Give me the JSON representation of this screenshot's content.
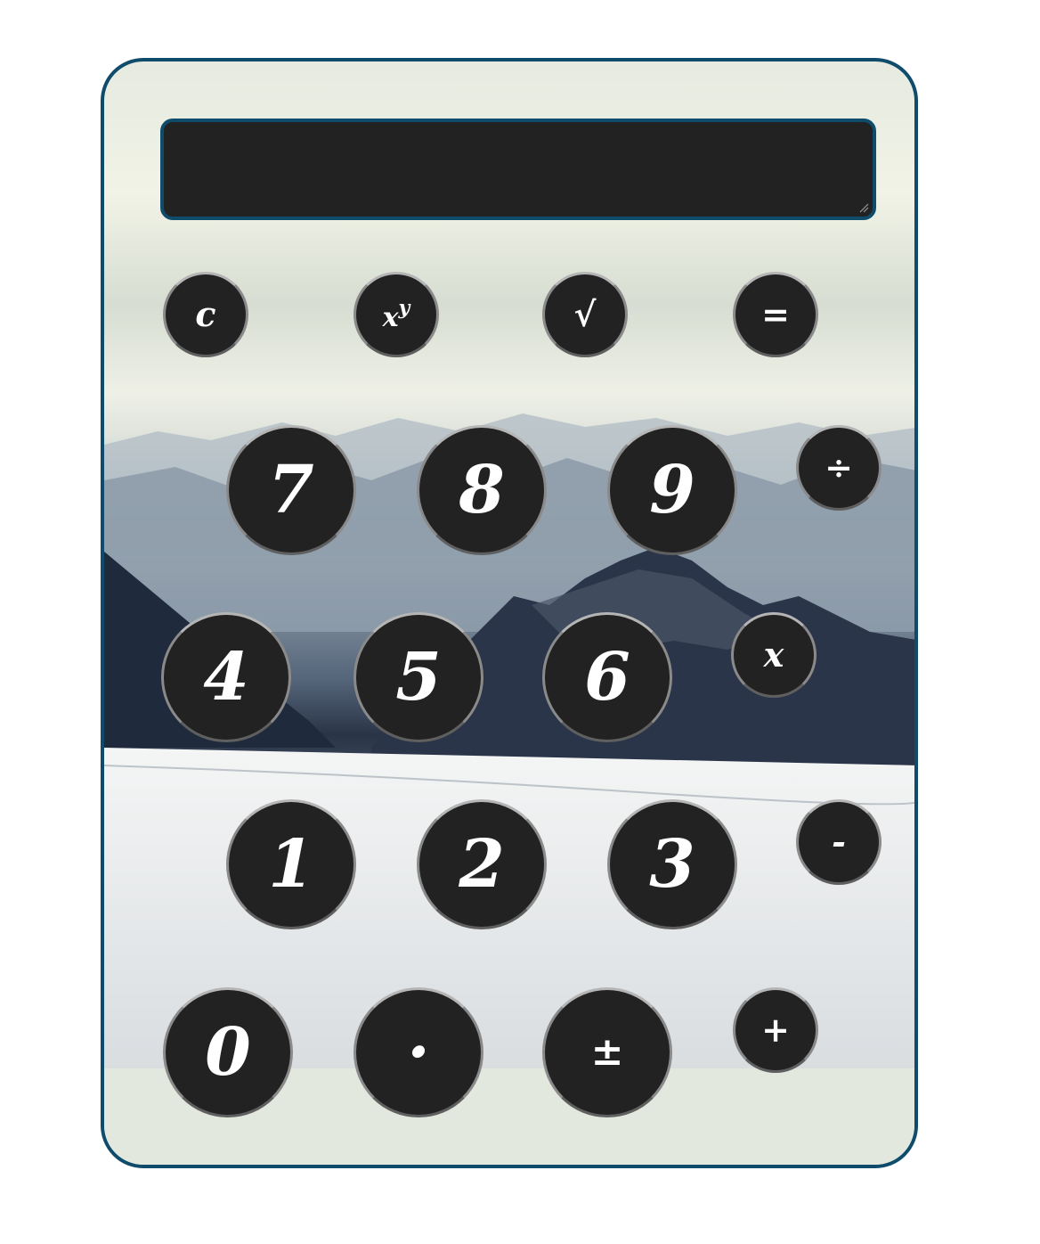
{
  "display": {
    "value": ""
  },
  "buttons": {
    "clear": "c",
    "power_base": "x",
    "power_exp": "y",
    "sqrt": "√",
    "equals": "=",
    "seven": "7",
    "eight": "8",
    "nine": "9",
    "divide": "÷",
    "four": "4",
    "five": "5",
    "six": "6",
    "multiply": "x",
    "one": "1",
    "two": "2",
    "three": "3",
    "subtract": "-",
    "zero": "0",
    "decimal": "·",
    "negate": "±",
    "add": "+"
  },
  "colors": {
    "frame_border": "#0f4c6b",
    "button_fill": "#222222",
    "button_text": "#ffffff",
    "display_fill": "#222222"
  }
}
